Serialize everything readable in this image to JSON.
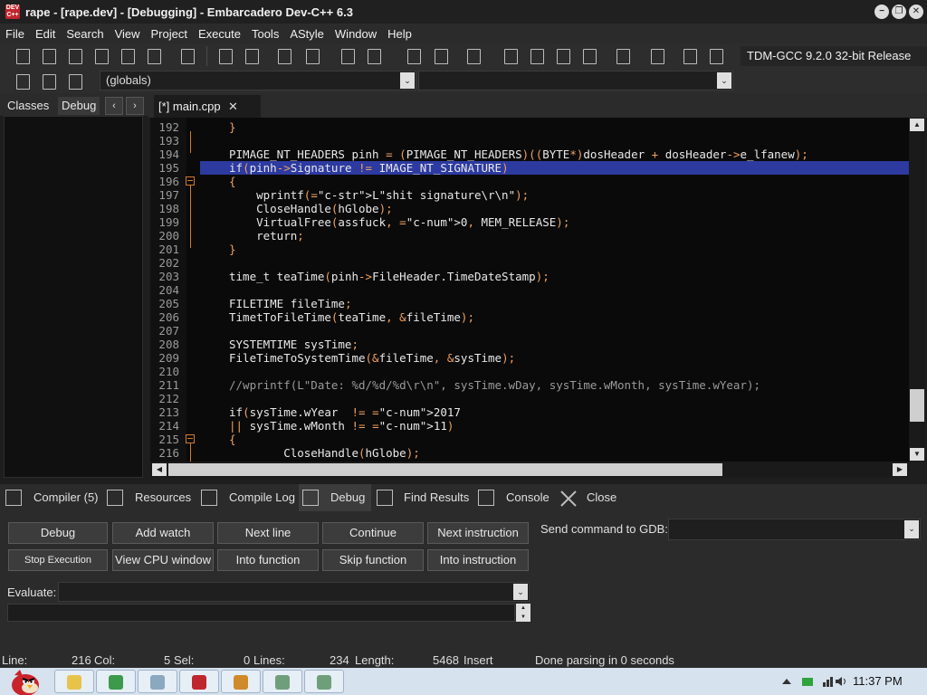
{
  "window": {
    "title": "rape - [rape.dev] - [Debugging] - Embarcadero Dev-C++ 6.3",
    "app_icon_text": "DEV C++",
    "minimize_glyph": "−",
    "restore_glyph": "❐",
    "close_glyph": "✕"
  },
  "menu": [
    "File",
    "Edit",
    "Search",
    "View",
    "Project",
    "Execute",
    "Tools",
    "AStyle",
    "Window",
    "Help"
  ],
  "toolbar": {
    "compiler": "TDM-GCC 9.2.0 32-bit Release",
    "scope_combo": "(globals)",
    "function_combo": "",
    "combo_arrow": "⌄"
  },
  "left_panel": {
    "tabs": [
      "Classes",
      "Debug"
    ],
    "active_tab": "Debug",
    "prev_glyph": "‹",
    "next_glyph": "›"
  },
  "editor": {
    "tab_label": "[*] main.cpp",
    "tab_close": "✕",
    "scroll_up": "▲",
    "scroll_down": "▼",
    "scroll_left": "◀",
    "scroll_right": "▶"
  },
  "code_lines": [
    {
      "ln": "192",
      "text": "}"
    },
    {
      "ln": "193",
      "text": ""
    },
    {
      "ln": "194",
      "text": "PIMAGE_NT_HEADERS pinh = (PIMAGE_NT_HEADERS)((BYTE*)dosHeader + dosHeader->e_lfanew);"
    },
    {
      "ln": "195",
      "text": "if(pinh->Signature != IMAGE_NT_SIGNATURE)"
    },
    {
      "ln": "196",
      "text": "{"
    },
    {
      "ln": "197",
      "text": "    wprintf(L\"shit signature\\r\\n\");"
    },
    {
      "ln": "198",
      "text": "    CloseHandle(hGlobe);"
    },
    {
      "ln": "199",
      "text": "    VirtualFree(assfuck, 0, MEM_RELEASE);"
    },
    {
      "ln": "200",
      "text": "    return;"
    },
    {
      "ln": "201",
      "text": "}"
    },
    {
      "ln": "202",
      "text": ""
    },
    {
      "ln": "203",
      "text": "time_t teaTime(pinh->FileHeader.TimeDateStamp);"
    },
    {
      "ln": "204",
      "text": ""
    },
    {
      "ln": "205",
      "text": "FILETIME fileTime;"
    },
    {
      "ln": "206",
      "text": "TimetToFileTime(teaTime, &fileTime);"
    },
    {
      "ln": "207",
      "text": ""
    },
    {
      "ln": "208",
      "text": "SYSTEMTIME sysTime;"
    },
    {
      "ln": "209",
      "text": "FileTimeToSystemTime(&fileTime, &sysTime);"
    },
    {
      "ln": "210",
      "text": ""
    },
    {
      "ln": "211",
      "text": "//wprintf(L\"Date: %d/%d/%d\\r\\n\", sysTime.wDay, sysTime.wMonth, sysTime.wYear);"
    },
    {
      "ln": "212",
      "text": ""
    },
    {
      "ln": "213",
      "text": "if(sysTime.wYear  != 2017"
    },
    {
      "ln": "214",
      "text": "|| sysTime.wMonth != 11)"
    },
    {
      "ln": "215",
      "text": "{"
    },
    {
      "ln": "216",
      "text": "        CloseHandle(hGlobe);"
    }
  ],
  "bottom_tabs": [
    "Compiler (5)",
    "Resources",
    "Compile Log",
    "Debug",
    "Find Results",
    "Console",
    "Close"
  ],
  "active_bottom_tab": "Debug",
  "debug_buttons_row1": [
    "Debug",
    "Add watch",
    "Next line",
    "Continue",
    "Next instruction"
  ],
  "debug_buttons_row2": [
    "Stop Execution",
    "View CPU window",
    "Into function",
    "Skip function",
    "Into instruction"
  ],
  "gdb": {
    "label": "Send command to GDB:",
    "value": ""
  },
  "evaluate": {
    "label": "Evaluate:",
    "value": ""
  },
  "status": {
    "line_label": "Line:",
    "line_value": "216",
    "col_label": "Col:",
    "col_value": "5",
    "sel_label": "Sel:",
    "sel_value": "0",
    "lines_label": "Lines:",
    "lines_value": "234",
    "length_label": "Length:",
    "length_value": "5468",
    "mode": "Insert",
    "message": "Done parsing in 0 seconds"
  },
  "taskbar": {
    "clock": "11:37 PM"
  }
}
